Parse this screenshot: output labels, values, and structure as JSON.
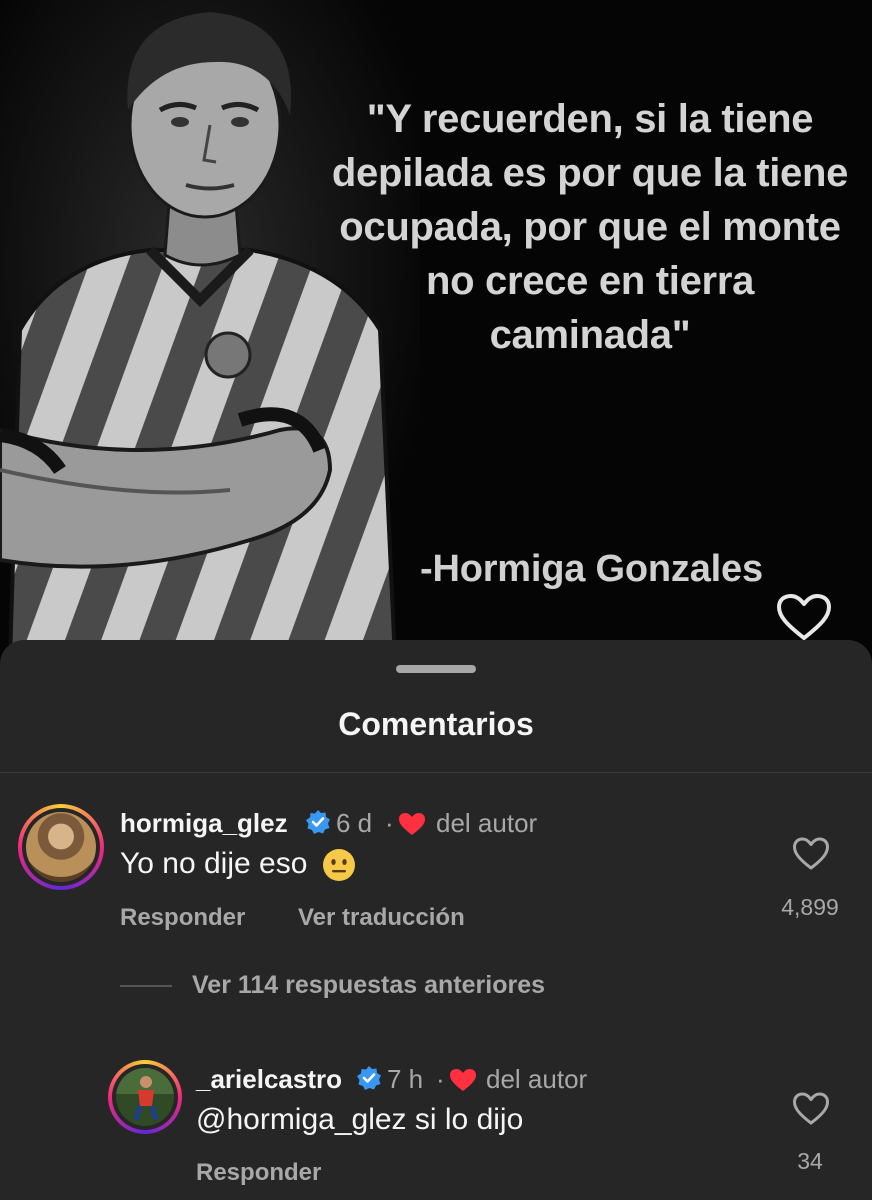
{
  "post": {
    "quote": "\"Y recuerden, si la tiene\ndepilada es por que la tiene\nocupada, por que el monte\nno crece en tierra\ncaminada\"",
    "author": "-Hormiga Gonzales",
    "icons": {
      "like": "heart-outline-icon"
    }
  },
  "sheet": {
    "title": "Comentarios",
    "comments": [
      {
        "username": "hormiga_glez",
        "time": "6 d",
        "separator": "·",
        "author_tag": "del autor",
        "text": "Yo no dije eso",
        "emoji": "😐",
        "reply_label": "Responder",
        "translate_label": "Ver traducción",
        "likes": "4,899"
      },
      {
        "username": "_arielcastro",
        "time": "7 h",
        "separator": "·",
        "author_tag": "del autor",
        "text": "@hormiga_glez si lo dijo",
        "reply_label": "Responder",
        "likes": "34"
      }
    ],
    "view_replies": "Ver 114 respuestas anteriores"
  },
  "colors": {
    "sheet_bg": "#262626",
    "text_primary": "#f5f5f5",
    "text_secondary": "#a8a8a8",
    "verified": "#3897f0",
    "author_heart": "#ff3040"
  }
}
